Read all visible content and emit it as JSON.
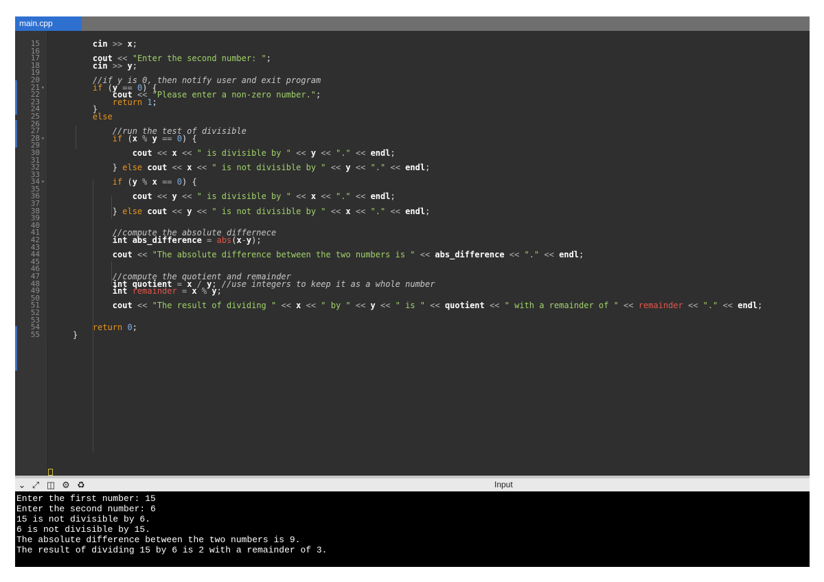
{
  "tab": {
    "title": "main.cpp"
  },
  "editor": {
    "lines": [
      {
        "n": "15",
        "fold": "",
        "tokens": [
          [
            "",
            "    "
          ],
          [
            "id",
            "cin"
          ],
          [
            "op",
            " >> "
          ],
          [
            "id",
            "x"
          ],
          [
            "",
            "; "
          ]
        ]
      },
      {
        "n": "16",
        "fold": "",
        "tokens": []
      },
      {
        "n": "17",
        "fold": "",
        "tokens": [
          [
            "",
            "    "
          ],
          [
            "id",
            "cout"
          ],
          [
            "op",
            " << "
          ],
          [
            "str",
            "\"Enter the second number: \""
          ],
          [
            "",
            ";"
          ]
        ]
      },
      {
        "n": "18",
        "fold": "",
        "tokens": [
          [
            "",
            "    "
          ],
          [
            "id",
            "cin"
          ],
          [
            "op",
            " >> "
          ],
          [
            "id",
            "y"
          ],
          [
            "",
            ";"
          ]
        ]
      },
      {
        "n": "19",
        "fold": "",
        "tokens": []
      },
      {
        "n": "20",
        "fold": "",
        "tokens": [
          [
            "",
            "    "
          ],
          [
            "cmt",
            "//if y is 0, then notify user and exit program"
          ]
        ]
      },
      {
        "n": "21",
        "fold": "v",
        "tokens": [
          [
            "",
            "    "
          ],
          [
            "kw",
            "if"
          ],
          [
            "",
            " ("
          ],
          [
            "id",
            "y"
          ],
          [
            "op",
            " == "
          ],
          [
            "num",
            "0"
          ],
          [
            "",
            ") {"
          ]
        ]
      },
      {
        "n": "22",
        "fold": "",
        "tokens": [
          [
            "",
            "        "
          ],
          [
            "id",
            "cout"
          ],
          [
            "op",
            " << "
          ],
          [
            "str",
            "\"Please enter a non-zero number.\""
          ],
          [
            "",
            ";"
          ]
        ]
      },
      {
        "n": "23",
        "fold": "",
        "tokens": [
          [
            "",
            "        "
          ],
          [
            "kw",
            "return"
          ],
          [
            "",
            " "
          ],
          [
            "num",
            "1"
          ],
          [
            "",
            ";"
          ]
        ]
      },
      {
        "n": "24",
        "fold": "",
        "tokens": [
          [
            "",
            "    }"
          ]
        ]
      },
      {
        "n": "25",
        "fold": "",
        "tokens": [
          [
            "",
            "    "
          ],
          [
            "kw",
            "else"
          ]
        ]
      },
      {
        "n": "26",
        "fold": "",
        "tokens": []
      },
      {
        "n": "27",
        "fold": "",
        "tokens": [
          [
            "",
            "        "
          ],
          [
            "cmt",
            "//run the test of divisible"
          ]
        ]
      },
      {
        "n": "28",
        "fold": "v",
        "tokens": [
          [
            "",
            "        "
          ],
          [
            "kw",
            "if"
          ],
          [
            "",
            " ("
          ],
          [
            "id",
            "x"
          ],
          [
            "op",
            " % "
          ],
          [
            "id",
            "y"
          ],
          [
            "op",
            " == "
          ],
          [
            "num",
            "0"
          ],
          [
            "",
            ") {"
          ]
        ]
      },
      {
        "n": "29",
        "fold": "",
        "tokens": []
      },
      {
        "n": "30",
        "fold": "",
        "tokens": [
          [
            "",
            "            "
          ],
          [
            "id",
            "cout"
          ],
          [
            "op",
            " << "
          ],
          [
            "id",
            "x"
          ],
          [
            "op",
            " << "
          ],
          [
            "str",
            "\" is divisible by \""
          ],
          [
            "op",
            " << "
          ],
          [
            "id",
            "y"
          ],
          [
            "op",
            " << "
          ],
          [
            "str",
            "\".\""
          ],
          [
            "op",
            " << "
          ],
          [
            "id",
            "endl"
          ],
          [
            "",
            ";"
          ]
        ]
      },
      {
        "n": "31",
        "fold": "",
        "tokens": []
      },
      {
        "n": "32",
        "fold": "",
        "tokens": [
          [
            "",
            "        } "
          ],
          [
            "kw",
            "else"
          ],
          [
            "",
            " "
          ],
          [
            "id",
            "cout"
          ],
          [
            "op",
            " << "
          ],
          [
            "id",
            "x"
          ],
          [
            "op",
            " << "
          ],
          [
            "str",
            "\" is not divisible by \""
          ],
          [
            "op",
            " << "
          ],
          [
            "id",
            "y"
          ],
          [
            "op",
            " << "
          ],
          [
            "str",
            "\".\""
          ],
          [
            "op",
            " << "
          ],
          [
            "id",
            "endl"
          ],
          [
            "",
            ";"
          ]
        ]
      },
      {
        "n": "33",
        "fold": "",
        "tokens": []
      },
      {
        "n": "34",
        "fold": "v",
        "tokens": [
          [
            "",
            "        "
          ],
          [
            "kw",
            "if"
          ],
          [
            "",
            " ("
          ],
          [
            "id",
            "y"
          ],
          [
            "op",
            " % "
          ],
          [
            "id",
            "x"
          ],
          [
            "op",
            " == "
          ],
          [
            "num",
            "0"
          ],
          [
            "",
            ") {"
          ]
        ]
      },
      {
        "n": "35",
        "fold": "",
        "tokens": []
      },
      {
        "n": "36",
        "fold": "",
        "tokens": [
          [
            "",
            "            "
          ],
          [
            "id",
            "cout"
          ],
          [
            "op",
            " << "
          ],
          [
            "id",
            "y"
          ],
          [
            "op",
            " << "
          ],
          [
            "str",
            "\" is divisible by \""
          ],
          [
            "op",
            " << "
          ],
          [
            "id",
            "x"
          ],
          [
            "op",
            " << "
          ],
          [
            "str",
            "\".\""
          ],
          [
            "op",
            " << "
          ],
          [
            "id",
            "endl"
          ],
          [
            "",
            ";"
          ]
        ]
      },
      {
        "n": "37",
        "fold": "",
        "tokens": []
      },
      {
        "n": "38",
        "fold": "",
        "tokens": [
          [
            "",
            "        } "
          ],
          [
            "kw",
            "else"
          ],
          [
            "",
            " "
          ],
          [
            "id",
            "cout"
          ],
          [
            "op",
            " << "
          ],
          [
            "id",
            "y"
          ],
          [
            "op",
            " << "
          ],
          [
            "str",
            "\" is not divisible by \""
          ],
          [
            "op",
            " << "
          ],
          [
            "id",
            "x"
          ],
          [
            "op",
            " << "
          ],
          [
            "str",
            "\".\""
          ],
          [
            "op",
            " << "
          ],
          [
            "id",
            "endl"
          ],
          [
            "",
            ";"
          ]
        ]
      },
      {
        "n": "39",
        "fold": "",
        "tokens": []
      },
      {
        "n": "40",
        "fold": "",
        "tokens": []
      },
      {
        "n": "41",
        "fold": "",
        "tokens": [
          [
            "",
            "        "
          ],
          [
            "cmt",
            "//compute the absolute differnece"
          ]
        ]
      },
      {
        "n": "42",
        "fold": "",
        "tokens": [
          [
            "",
            "        "
          ],
          [
            "id",
            "int abs_difference"
          ],
          [
            "op",
            " = "
          ],
          [
            "fn",
            "abs"
          ],
          [
            "",
            "("
          ],
          [
            "id",
            "x"
          ],
          [
            "op",
            "-"
          ],
          [
            "id",
            "y"
          ],
          [
            "",
            ");"
          ]
        ]
      },
      {
        "n": "43",
        "fold": "",
        "tokens": []
      },
      {
        "n": "44",
        "fold": "",
        "tokens": [
          [
            "",
            "        "
          ],
          [
            "id",
            "cout"
          ],
          [
            "op",
            " << "
          ],
          [
            "str",
            "\"The absolute difference between the two numbers is \""
          ],
          [
            "op",
            " << "
          ],
          [
            "id",
            "abs_difference"
          ],
          [
            "op",
            " << "
          ],
          [
            "str",
            "\".\""
          ],
          [
            "op",
            " << "
          ],
          [
            "id",
            "endl"
          ],
          [
            "",
            ";"
          ]
        ]
      },
      {
        "n": "45",
        "fold": "",
        "tokens": []
      },
      {
        "n": "46",
        "fold": "",
        "tokens": []
      },
      {
        "n": "47",
        "fold": "",
        "tokens": [
          [
            "",
            "        "
          ],
          [
            "cmt",
            "//compute the quotient and remainder"
          ]
        ]
      },
      {
        "n": "48",
        "fold": "",
        "tokens": [
          [
            "",
            "        "
          ],
          [
            "id",
            "int quotient"
          ],
          [
            "op",
            " = "
          ],
          [
            "id",
            "x"
          ],
          [
            "op",
            " / "
          ],
          [
            "id",
            "y"
          ],
          [
            "",
            "; "
          ],
          [
            "cmt",
            "//use integers to keep it as a whole number"
          ]
        ]
      },
      {
        "n": "49",
        "fold": "",
        "tokens": [
          [
            "",
            "        "
          ],
          [
            "id",
            "int "
          ],
          [
            "fn",
            "remainder"
          ],
          [
            "op",
            " = "
          ],
          [
            "id",
            "x"
          ],
          [
            "op",
            " % "
          ],
          [
            "id",
            "y"
          ],
          [
            "",
            ";"
          ]
        ]
      },
      {
        "n": "50",
        "fold": "",
        "tokens": []
      },
      {
        "n": "51",
        "fold": "",
        "tokens": [
          [
            "",
            "        "
          ],
          [
            "id",
            "cout"
          ],
          [
            "op",
            " << "
          ],
          [
            "str",
            "\"The result of dividing \""
          ],
          [
            "op",
            " << "
          ],
          [
            "id",
            "x"
          ],
          [
            "op",
            " << "
          ],
          [
            "str",
            "\" by \""
          ],
          [
            "op",
            " << "
          ],
          [
            "id",
            "y"
          ],
          [
            "op",
            " << "
          ],
          [
            "str",
            "\" is \""
          ],
          [
            "op",
            " << "
          ],
          [
            "id",
            "quotient"
          ],
          [
            "op",
            " << "
          ],
          [
            "str",
            "\" with a remainder of \""
          ],
          [
            "op",
            " << "
          ],
          [
            "fn",
            "remainder"
          ],
          [
            "op",
            " << "
          ],
          [
            "str",
            "\".\""
          ],
          [
            "op",
            " << "
          ],
          [
            "id",
            "endl"
          ],
          [
            "",
            ";"
          ]
        ]
      },
      {
        "n": "52",
        "fold": "",
        "tokens": []
      },
      {
        "n": "53",
        "fold": "",
        "tokens": []
      },
      {
        "n": "54",
        "fold": "",
        "tokens": [
          [
            "",
            "    "
          ],
          [
            "kw",
            "return"
          ],
          [
            "",
            " "
          ],
          [
            "num",
            "0"
          ],
          [
            "",
            ";"
          ]
        ]
      },
      {
        "n": "55",
        "fold": "",
        "tokens": [
          [
            "",
            "}"
          ]
        ]
      }
    ]
  },
  "toolbar": {
    "icons": [
      "chevron-down-icon",
      "expand-icon",
      "split-panel-icon",
      "gear-icon",
      "clear-icon"
    ],
    "input_label": "Input"
  },
  "console": {
    "lines": [
      "Enter the first number: 15",
      "Enter the second number: 6",
      "15 is not divisible by 6.",
      "6 is not divisible by 15.",
      "The absolute difference between the two numbers is 9.",
      "The result of dividing 15 by 6 is 2 with a remainder of 3."
    ]
  }
}
